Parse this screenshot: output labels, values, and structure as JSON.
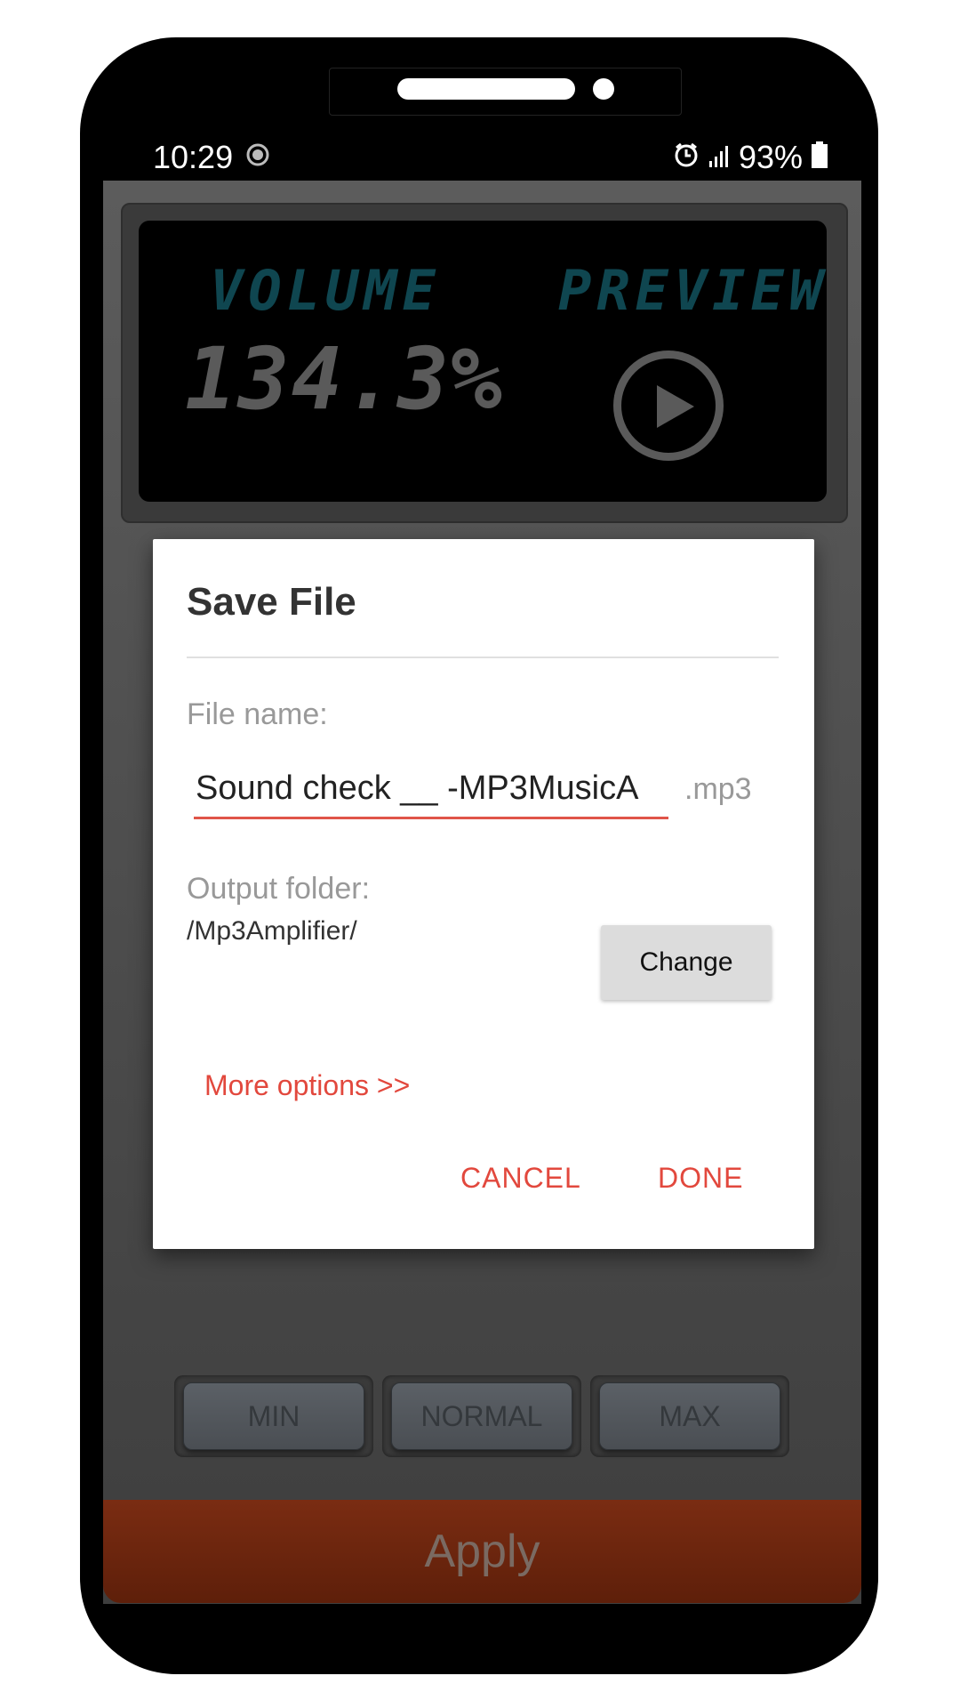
{
  "status_bar": {
    "time": "10:29",
    "battery": "93%",
    "icons": [
      "record-icon",
      "alarm-icon",
      "signal-icon",
      "battery-icon"
    ]
  },
  "display": {
    "volume_label": "VOLUME",
    "volume_value": "134.3%",
    "preview_label": "PREVIEW"
  },
  "dialog": {
    "title": "Save File",
    "file_name_label": "File name:",
    "file_name_value": "Sound check __ -MP3MusicA",
    "extension": ".mp3",
    "output_folder_label": "Output folder:",
    "output_folder_value": "/Mp3Amplifier/",
    "change_label": "Change",
    "more_options_label": "More options >>",
    "cancel_label": "CANCEL",
    "done_label": "DONE"
  },
  "presets": {
    "min_label": "MIN",
    "normal_label": "NORMAL",
    "max_label": "MAX"
  },
  "apply_label": "Apply",
  "colors": {
    "accent": "#e2483d",
    "lcd_label": "#0f4650",
    "apply_bar": "#6b2510"
  }
}
